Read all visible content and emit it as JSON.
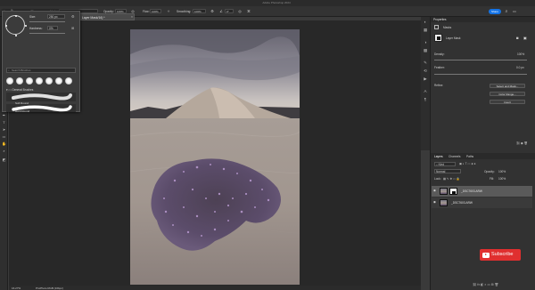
{
  "app": {
    "window_title": "Adobe Photoshop 2024"
  },
  "options_bar": {
    "mode_label": "Mode:",
    "mode_value": "Normal",
    "opacity_label": "Opacity:",
    "opacity_value": "100%",
    "flow_label": "Flow:",
    "flow_value": "100%",
    "smoothing_label": "Smoothing:",
    "smoothing_value": "100%",
    "angle_value": "0°",
    "share_label": "Share"
  },
  "document": {
    "tab_label": "Layer Mask/16) *",
    "zoom": "16.27%",
    "profile": "ProPhoto RGB (16bpc)"
  },
  "brush_popup": {
    "size_label": "Size:",
    "size_value": "250 px",
    "hardness_label": "Hardness:",
    "hardness_value": "0%",
    "search_placeholder": "Search Brushes",
    "group_name": "General Brushes",
    "preset_count": 7,
    "strokes": [
      {
        "label": "Soft Round"
      },
      {
        "label": "Hard Round"
      }
    ]
  },
  "properties": {
    "panel_title": "Properties",
    "masks_label": "Masks",
    "layer_mask_label": "Layer Mask",
    "density_label": "Density:",
    "density_value": "100%",
    "feather_label": "Feather:",
    "feather_value": "0.0 px",
    "refine_label": "Refine:",
    "select_mask_btn": "Select and Mask...",
    "color_range_btn": "Color Range...",
    "invert_btn": "Invert"
  },
  "layers": {
    "tabs": [
      "Layers",
      "Channels",
      "Paths"
    ],
    "kind_label": "Kind",
    "blend_mode": "Normal",
    "opacity_label": "Opacity:",
    "opacity_value": "100%",
    "lock_label": "Lock:",
    "fill_label": "Fill:",
    "fill_value": "100%",
    "rows": [
      {
        "name": "_DSC7603.ARW",
        "selected": true,
        "has_mask": true
      },
      {
        "name": "_DSC7603.ARW",
        "selected": false,
        "has_mask": false
      }
    ]
  },
  "overlay": {
    "subscribe_label": "Subscribe"
  },
  "colors": {
    "accent": "#1473e6",
    "subscribe": "#e02f2f",
    "panel": "#323232",
    "canvas": "#282828"
  }
}
